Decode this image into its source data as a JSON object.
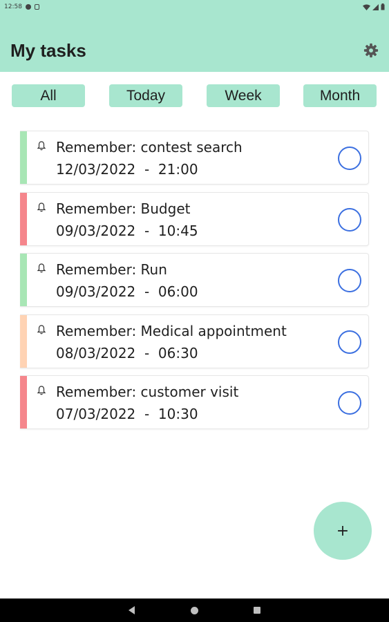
{
  "status_bar": {
    "time": "12:58"
  },
  "app_bar": {
    "title": "My tasks",
    "settings_icon": "gear-icon"
  },
  "filters": [
    {
      "label": "All"
    },
    {
      "label": "Today"
    },
    {
      "label": "Week"
    },
    {
      "label": "Month"
    }
  ],
  "tasks": [
    {
      "title": "Remember: contest search",
      "date": "12/03/2022",
      "time": "21:00",
      "datetime": "12/03/2022  -  21:00",
      "color": "#a8e6b5",
      "icon": "bell-icon"
    },
    {
      "title": "Remember: Budget",
      "date": "09/03/2022",
      "time": "10:45",
      "datetime": "09/03/2022  -  10:45",
      "color": "#f5868c",
      "icon": "bell-icon"
    },
    {
      "title": "Remember: Run",
      "date": "09/03/2022",
      "time": "06:00",
      "datetime": "09/03/2022  -  06:00",
      "color": "#a8e6b5",
      "icon": "bell-icon"
    },
    {
      "title": "Remember: Medical appointment",
      "date": "08/03/2022",
      "time": "06:30",
      "datetime": "08/03/2022  -  06:30",
      "color": "#ffd3b4",
      "icon": "bell-icon"
    },
    {
      "title": "Remember: customer visit",
      "date": "07/03/2022",
      "time": "10:30",
      "datetime": "07/03/2022  -  10:30",
      "color": "#f5868c",
      "icon": "bell-icon"
    }
  ],
  "fab": {
    "label": "+"
  },
  "colors": {
    "accent": "#a8e6cf",
    "check_ring": "#3b6fe0"
  }
}
